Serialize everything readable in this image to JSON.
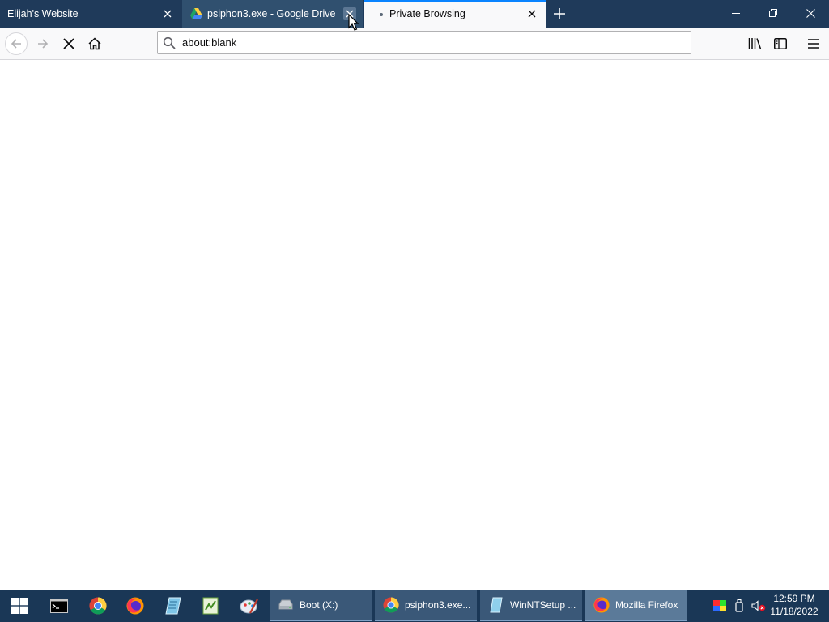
{
  "browser": {
    "tabs": [
      {
        "title": "Elijah's Website",
        "active": false
      },
      {
        "title": "psiphon3.exe - Google Drive",
        "active": false,
        "icon": "google-drive-icon"
      },
      {
        "title": "Private Browsing",
        "active": true
      }
    ],
    "url": "about:blank",
    "colors": {
      "tabbar": "#1f3a5a",
      "active_tab": "#f9f9fa",
      "accent": "#0a84ff",
      "toolbar": "#f9f9fa"
    }
  },
  "taskbar": {
    "pinned": [
      "windows-start-icon",
      "terminal-icon",
      "chrome-icon",
      "firefox-icon",
      "notepad-icon",
      "winntsetup-icon",
      "paint-icon"
    ],
    "apps": [
      {
        "label": "Boot (X:)",
        "icon": "drive-icon"
      },
      {
        "label": "psiphon3.exe...",
        "icon": "chrome-icon"
      },
      {
        "label": "WinNTSetup ...",
        "icon": "winntsetup-icon"
      },
      {
        "label": "Mozilla Firefox",
        "icon": "firefox-icon",
        "active": true
      }
    ],
    "tray": [
      "color-icon",
      "usb-icon",
      "volume-muted-icon"
    ],
    "clock": {
      "time": "12:59 PM",
      "date": "11/18/2022"
    },
    "colors": {
      "background": "#1a3756"
    }
  }
}
